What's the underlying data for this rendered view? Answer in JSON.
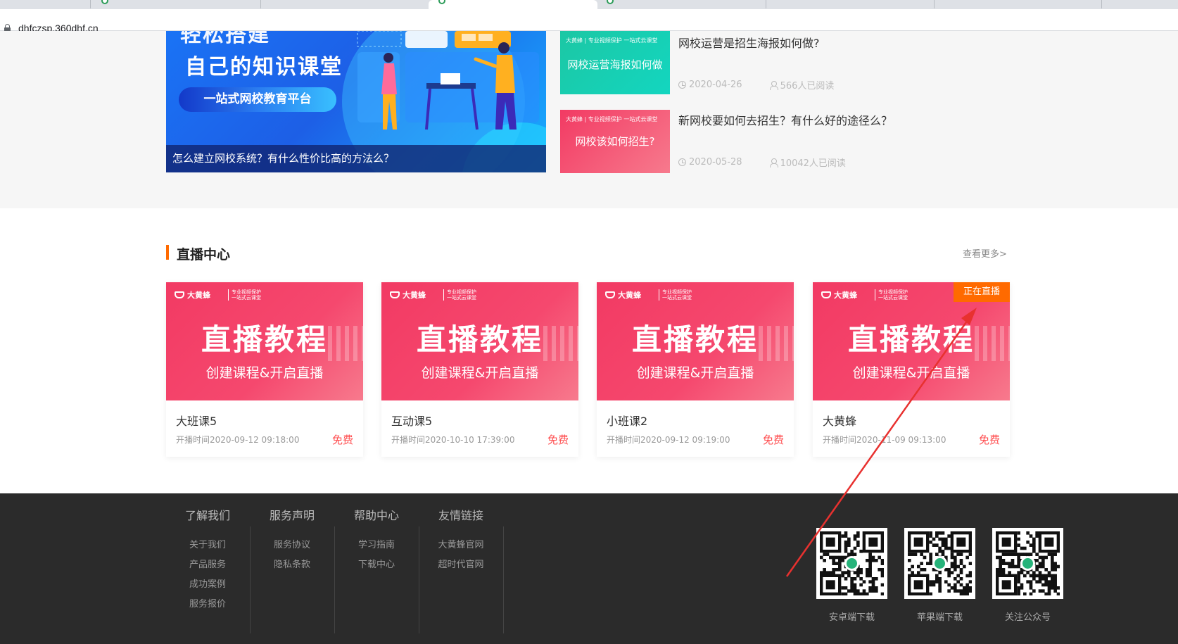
{
  "browser": {
    "url": "dhfczsp.360dhf.cn"
  },
  "banner": {
    "headline_top": "轻松搭建",
    "headline": "自己的知识课堂",
    "pill": "一站式网校教育平台",
    "caption": "怎么建立网校系统？有什么性价比高的方法么？"
  },
  "news": [
    {
      "thumb_brand": "大黄蜂 | 专业视频保护 一站式云课堂",
      "thumb_title": "网校运营海报如何做",
      "title": "网校运营是招生海报如何做?",
      "date": "2020-04-26",
      "reads": "566人已阅读",
      "color_from": "#1cc7a4",
      "color_to": "#13d6c0"
    },
    {
      "thumb_brand": "大黄蜂 | 专业视频保护 一站式云课堂",
      "thumb_title": "网校该如何招生?",
      "title": "新网校要如何去招生？有什么好的途径么？",
      "date": "2020-05-28",
      "reads": "10042人已阅读",
      "color_from": "#f23a63",
      "color_to": "#f77a8d"
    }
  ],
  "live_section": {
    "title": "直播中心",
    "more": "查看更多>"
  },
  "cards": [
    {
      "brand": "大黄蜂",
      "brand_sub": "专业视频保护\n一站式云课堂",
      "big": "直播教程",
      "sub": "创建课程&开启直播",
      "name": "大班课5",
      "time": "开播时间2020-09-12 09:18:00",
      "price": "免费"
    },
    {
      "brand": "大黄蜂",
      "brand_sub": "专业视频保护\n一站式云课堂",
      "big": "直播教程",
      "sub": "创建课程&开启直播",
      "name": "互动课5",
      "time": "开播时间2020-10-10 17:39:00",
      "price": "免费"
    },
    {
      "brand": "大黄蜂",
      "brand_sub": "专业视频保护\n一站式云课堂",
      "big": "直播教程",
      "sub": "创建课程&开启直播",
      "name": "小班课2",
      "time": "开播时间2020-09-12 09:19:00",
      "price": "免费"
    },
    {
      "brand": "大黄蜂",
      "brand_sub": "专业视频保护\n一站式云课堂",
      "big": "直播教程",
      "sub": "创建课程&开启直播",
      "name": "大黄蜂",
      "time": "开播时间2020-11-09 09:13:00",
      "price": "免费",
      "badge": "正在直播"
    }
  ],
  "footer": {
    "columns": [
      {
        "head": "了解我们",
        "links": [
          "关于我们",
          "产品服务",
          "成功案例",
          "服务报价"
        ]
      },
      {
        "head": "服务声明",
        "links": [
          "服务协议",
          "隐私条款"
        ]
      },
      {
        "head": "帮助中心",
        "links": [
          "学习指南",
          "下载中心"
        ]
      },
      {
        "head": "友情链接",
        "links": [
          "大黄蜂官网",
          "超时代官网"
        ]
      }
    ],
    "qrcodes": [
      {
        "label": "安卓端下载",
        "icon": "android-app-icon"
      },
      {
        "label": "苹果端下载",
        "icon": "ios-app-icon"
      },
      {
        "label": "关注公众号",
        "icon": "wechat-account-icon"
      }
    ]
  },
  "colors": {
    "accent": "#ff6a00",
    "price": "#ff4d4f",
    "footer_bg": "#2b2b2b",
    "annotation": "#e8312f"
  }
}
